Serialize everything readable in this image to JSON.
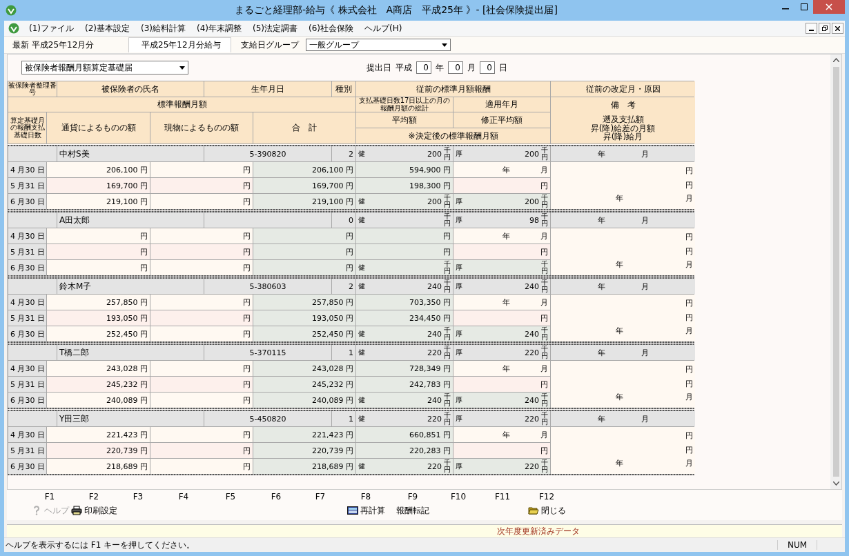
{
  "window": {
    "title": "まるごと経理部-給与《 株式会社　A商店　平成25年 》- [社会保険提出届]"
  },
  "menu": [
    {
      "label": "(1)ファイル"
    },
    {
      "label": "(2)基本設定"
    },
    {
      "label": "(3)給料計算"
    },
    {
      "label": "(4)年末調整"
    },
    {
      "label": "(5)法定調書"
    },
    {
      "label": "(6)社会保険"
    },
    {
      "label": "ヘルプ(H)"
    }
  ],
  "info": {
    "latest": "最新 平成25年12月分",
    "period": "平成25年12月分給与",
    "group_label": "支給日グループ",
    "group_value": "一般グループ"
  },
  "form": {
    "doc_type": "被保険者報酬月額算定基礎届",
    "date_label": "提出日",
    "era": "平成",
    "year": "0",
    "year_unit": "年",
    "month": "0",
    "month_unit": "月",
    "day": "0",
    "day_unit": "日"
  },
  "table": {
    "header": {
      "number": "被保険者整理番号",
      "name": "被保険者の氏名",
      "birth": "生年月日",
      "kind": "種別",
      "previous": "従前の標準月額報酬",
      "revision": "従前の改定月・原因",
      "standard": "標準報酬月額",
      "sum": "支払基礎日数17日以上の月の報酬月額の総計",
      "applied": "適用年月",
      "days": "算定基礎月の報酬支払基礎日数",
      "cash": "通貨によるものの額",
      "goods": "現物によるものの額",
      "total": "合　計",
      "average": "平均額",
      "corrected": "修正平均額",
      "decided": "※決定後の標準報酬月額",
      "remarks_title": "備　考",
      "remarks_lines": [
        "遡及支払額",
        "昇(降)給差の月額",
        "昇(降)給月"
      ]
    },
    "employees": [
      {
        "name": "中村S美",
        "birth": "5-390820",
        "kind": "2",
        "prev_health": {
          "label": "健",
          "value": "200",
          "unit": "千円"
        },
        "prev_pension": {
          "label": "厚",
          "value": "200",
          "unit": "千円"
        },
        "revision": {
          "year": "年",
          "month": "月"
        },
        "months": [
          {
            "date": "4 月30 日",
            "cash": "206,100 円",
            "goods": "円",
            "total": "206,100 円"
          },
          {
            "date": "5 月31 日",
            "cash": "169,700 円",
            "goods": "円",
            "total": "169,700 円"
          },
          {
            "date": "6 月30 日",
            "cash": "219,100 円",
            "goods": "円",
            "total": "219,100 円"
          }
        ],
        "sum": "594,900 円",
        "applied": {
          "year": "年",
          "month": "月"
        },
        "average": "198,300 円",
        "corrected": "円",
        "decided_health": {
          "label": "健",
          "value": "200",
          "unit": "千円"
        },
        "decided_pension": {
          "label": "厚",
          "value": "200",
          "unit": "千円"
        },
        "remarks": {
          "retro": "円",
          "diff": "円",
          "year": "年",
          "month": "月"
        }
      },
      {
        "name": "A田太郎",
        "kind": "0",
        "prev_health": {
          "label": "健",
          "unit": "千円"
        },
        "prev_pension": {
          "label": "厚",
          "value": "98",
          "unit": "千円"
        },
        "revision": {
          "year": "年",
          "month": "月"
        },
        "months": [
          {
            "date": "4 月30 日",
            "cash": "円",
            "goods": "円",
            "total": "円"
          },
          {
            "date": "5 月31 日",
            "cash": "円",
            "goods": "円",
            "total": "円"
          },
          {
            "date": "6 月30 日",
            "cash": "円",
            "goods": "円",
            "total": "円"
          }
        ],
        "sum": "円",
        "applied": {
          "year": "年",
          "month": "月"
        },
        "average": "円",
        "corrected": "円",
        "decided_health": {
          "label": "健",
          "unit": "千円"
        },
        "decided_pension": {
          "label": "厚",
          "unit": "千円"
        },
        "remarks": {
          "retro": "円",
          "diff": "円",
          "year": "年",
          "month": "月"
        }
      },
      {
        "name": "鈴木M子",
        "birth": "5-380603",
        "kind": "2",
        "prev_health": {
          "label": "健",
          "value": "240",
          "unit": "千円"
        },
        "prev_pension": {
          "label": "厚",
          "value": "240",
          "unit": "千円"
        },
        "revision": {
          "year": "年",
          "month": "月"
        },
        "months": [
          {
            "date": "4 月30 日",
            "cash": "257,850 円",
            "goods": "円",
            "total": "257,850 円"
          },
          {
            "date": "5 月31 日",
            "cash": "193,050 円",
            "goods": "円",
            "total": "193,050 円"
          },
          {
            "date": "6 月30 日",
            "cash": "252,450 円",
            "goods": "円",
            "total": "252,450 円"
          }
        ],
        "sum": "703,350 円",
        "applied": {
          "year": "年",
          "month": "月"
        },
        "average": "234,450 円",
        "corrected": "円",
        "decided_health": {
          "label": "健",
          "value": "240",
          "unit": "千円"
        },
        "decided_pension": {
          "label": "厚",
          "value": "240",
          "unit": "千円"
        },
        "remarks": {
          "retro": "円",
          "diff": "円",
          "year": "年",
          "month": "月"
        }
      },
      {
        "name": "T橋二郎",
        "birth": "5-370115",
        "kind": "1",
        "prev_health": {
          "label": "健",
          "value": "220",
          "unit": "千円"
        },
        "prev_pension": {
          "label": "厚",
          "value": "220",
          "unit": "千円"
        },
        "revision": {
          "year": "年",
          "month": "月"
        },
        "months": [
          {
            "date": "4 月30 日",
            "cash": "243,028 円",
            "goods": "円",
            "total": "243,028 円"
          },
          {
            "date": "5 月31 日",
            "cash": "245,232 円",
            "goods": "円",
            "total": "245,232 円"
          },
          {
            "date": "6 月30 日",
            "cash": "240,089 円",
            "goods": "円",
            "total": "240,089 円"
          }
        ],
        "sum": "728,349 円",
        "applied": {
          "year": "年",
          "month": "月"
        },
        "average": "242,783 円",
        "corrected": "円",
        "decided_health": {
          "label": "健",
          "value": "240",
          "unit": "千円"
        },
        "decided_pension": {
          "label": "厚",
          "value": "240",
          "unit": "千円"
        },
        "remarks": {
          "retro": "円",
          "diff": "円",
          "year": "年",
          "month": "月"
        }
      },
      {
        "name": "Y田三郎",
        "birth": "5-450820",
        "kind": "1",
        "prev_health": {
          "label": "健",
          "value": "220",
          "unit": "千円"
        },
        "prev_pension": {
          "label": "厚",
          "value": "220",
          "unit": "千円"
        },
        "revision": {
          "year": "年",
          "month": "月"
        },
        "months": [
          {
            "date": "4 月30 日",
            "cash": "221,423 円",
            "goods": "円",
            "total": "221,423 円"
          },
          {
            "date": "5 月31 日",
            "cash": "220,739 円",
            "goods": "円",
            "total": "220,739 円"
          },
          {
            "date": "6 月30 日",
            "cash": "218,689 円",
            "goods": "円",
            "total": "218,689 円"
          }
        ],
        "sum": "660,851 円",
        "applied": {
          "year": "年",
          "month": "月"
        },
        "average": "220,283 円",
        "corrected": "円",
        "decided_health": {
          "label": "健",
          "value": "220",
          "unit": "千円"
        },
        "decided_pension": {
          "label": "厚",
          "value": "220",
          "unit": "千円"
        },
        "remarks": {
          "retro": "円",
          "diff": "円",
          "year": "年",
          "month": "月"
        }
      }
    ]
  },
  "function_keys": [
    {
      "key": "F1",
      "action": "ヘルプ",
      "disabled": true
    },
    {
      "key": "F2",
      "action": "印刷設定",
      "disabled": false
    },
    {
      "key": "F3"
    },
    {
      "key": "F4"
    },
    {
      "key": "F5"
    },
    {
      "key": "F6"
    },
    {
      "key": "F7"
    },
    {
      "key": "F8",
      "action": "再計算",
      "disabled": false
    },
    {
      "key": "F9",
      "action": "報酬転記",
      "disabled": false
    },
    {
      "key": "F10"
    },
    {
      "key": "F11"
    },
    {
      "key": "F12",
      "action": "閉じる",
      "disabled": false
    }
  ],
  "notice": "次年度更新済みデータ",
  "status_bar": {
    "text": "ヘルプを表示するには F1 キーを押してください。",
    "num": "NUM"
  }
}
